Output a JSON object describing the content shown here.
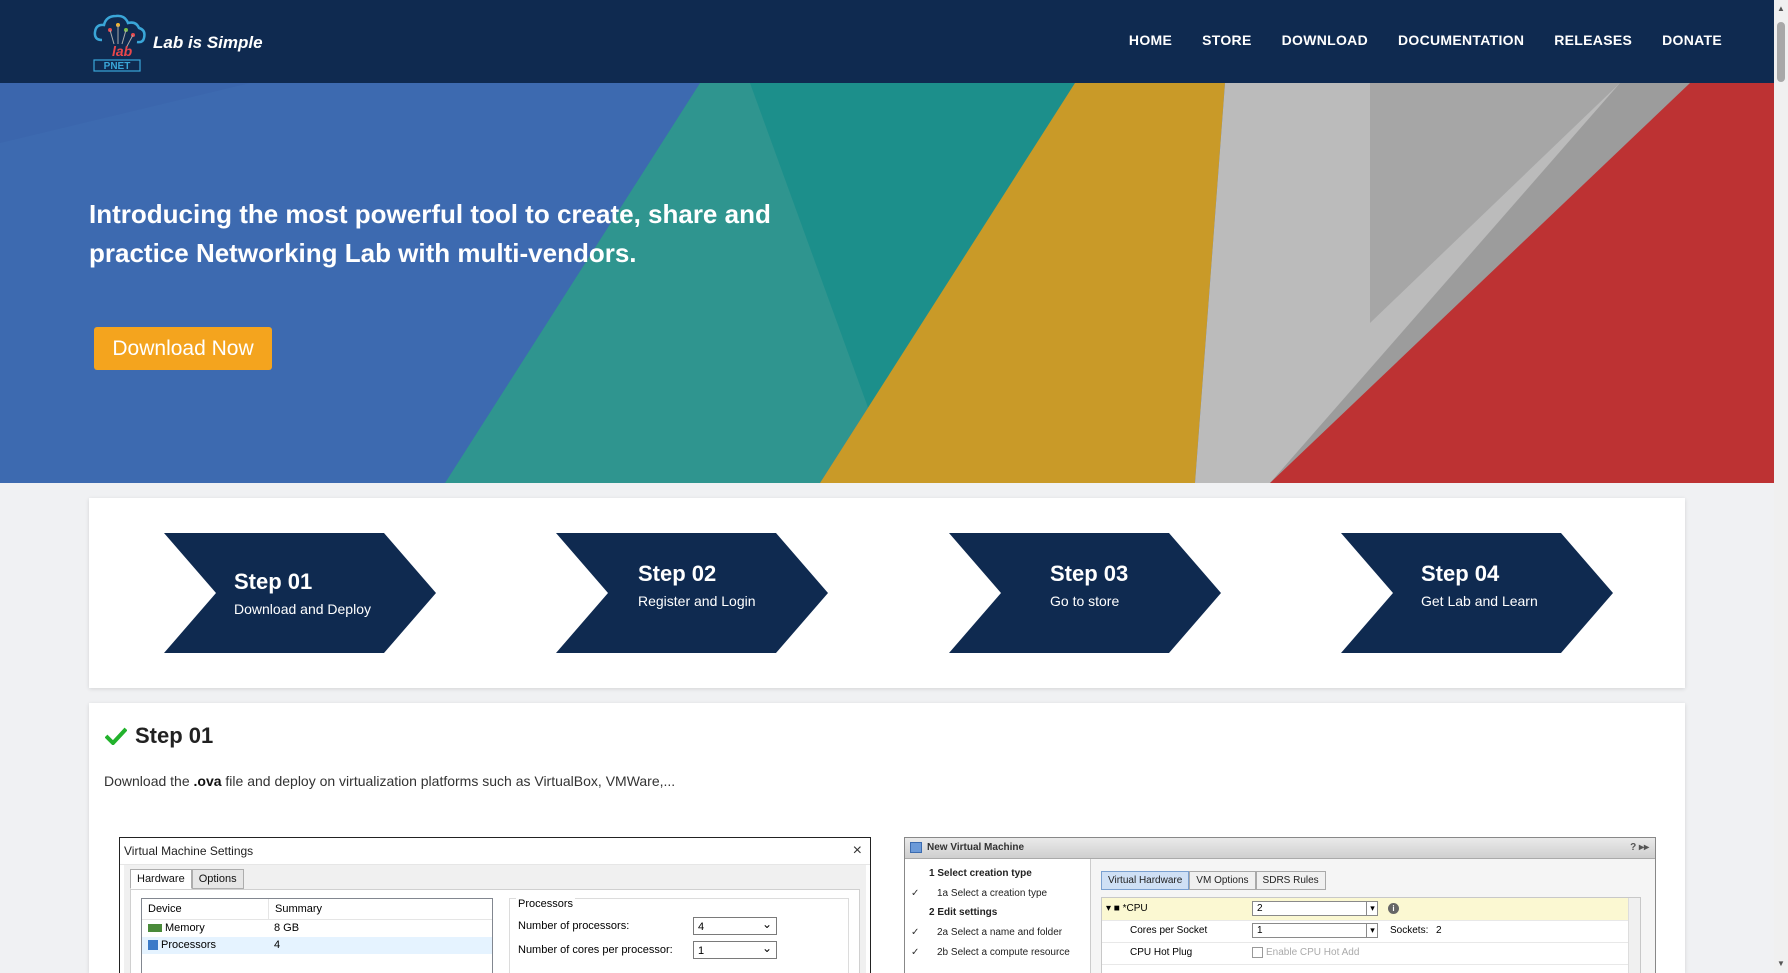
{
  "header": {
    "brand": "Lab is Simple",
    "logo_text": "PNET",
    "logo_mark": "lab",
    "nav": [
      "HOME",
      "STORE",
      "DOWNLOAD",
      "DOCUMENTATION",
      "RELEASES",
      "DONATE"
    ]
  },
  "hero": {
    "title": "Introducing the most powerful tool to create, share and practice Networking Lab with multi-vendors.",
    "cta_label": "Download Now",
    "colors": {
      "blue": "#3b66ad",
      "teal": "#2f958f",
      "yellow": "#c99a28",
      "gray": "#b8b8b8",
      "red": "#bd3233",
      "cta": "#f4a41e"
    }
  },
  "steps": [
    {
      "number": "Step 01",
      "label": "Download and Deploy"
    },
    {
      "number": "Step 02",
      "label": "Register and Login"
    },
    {
      "number": "Step 03",
      "label": "Go to store"
    },
    {
      "number": "Step 04",
      "label": "Get Lab and Learn"
    }
  ],
  "step_detail": {
    "title": "Step 01",
    "desc_pre": "Download the ",
    "desc_bold": ".ova",
    "desc_post": " file and deploy on virtualization platforms such as VirtualBox, VMWare,..."
  },
  "vm_settings": {
    "title": "Virtual Machine Settings",
    "close_icon": "×",
    "tabs": [
      "Hardware",
      "Options"
    ],
    "columns": [
      "Device",
      "Summary"
    ],
    "rows": [
      {
        "device": "Memory",
        "summary": "8 GB"
      },
      {
        "device": "Processors",
        "summary": "4"
      }
    ],
    "group_label": "Processors",
    "num_processors_label": "Number of processors:",
    "num_processors_value": "4",
    "cores_label": "Number of cores per processor:",
    "cores_value": "1"
  },
  "new_vm": {
    "title": "New Virtual Machine",
    "controls": "? ▸▸",
    "steps": [
      {
        "text": "1  Select creation type",
        "bold": true,
        "check": ""
      },
      {
        "text": "1a  Select a creation type",
        "bold": false,
        "check": "✓"
      },
      {
        "text": "2  Edit settings",
        "bold": true,
        "check": ""
      },
      {
        "text": "2a  Select a name and folder",
        "bold": false,
        "check": "✓"
      },
      {
        "text": "2b  Select a compute resource",
        "bold": false,
        "check": "✓"
      }
    ],
    "tabs": [
      "Virtual Hardware",
      "VM Options",
      "SDRS Rules"
    ],
    "cpu_label": "▾ ■ *CPU",
    "cpu_value": "2",
    "cores_label": "Cores per Socket",
    "cores_value": "1",
    "sockets_label": "Sockets:",
    "sockets_value": "2",
    "hotplug_label": "CPU Hot Plug",
    "hotplug_checkbox": "Enable CPU Hot Add"
  }
}
